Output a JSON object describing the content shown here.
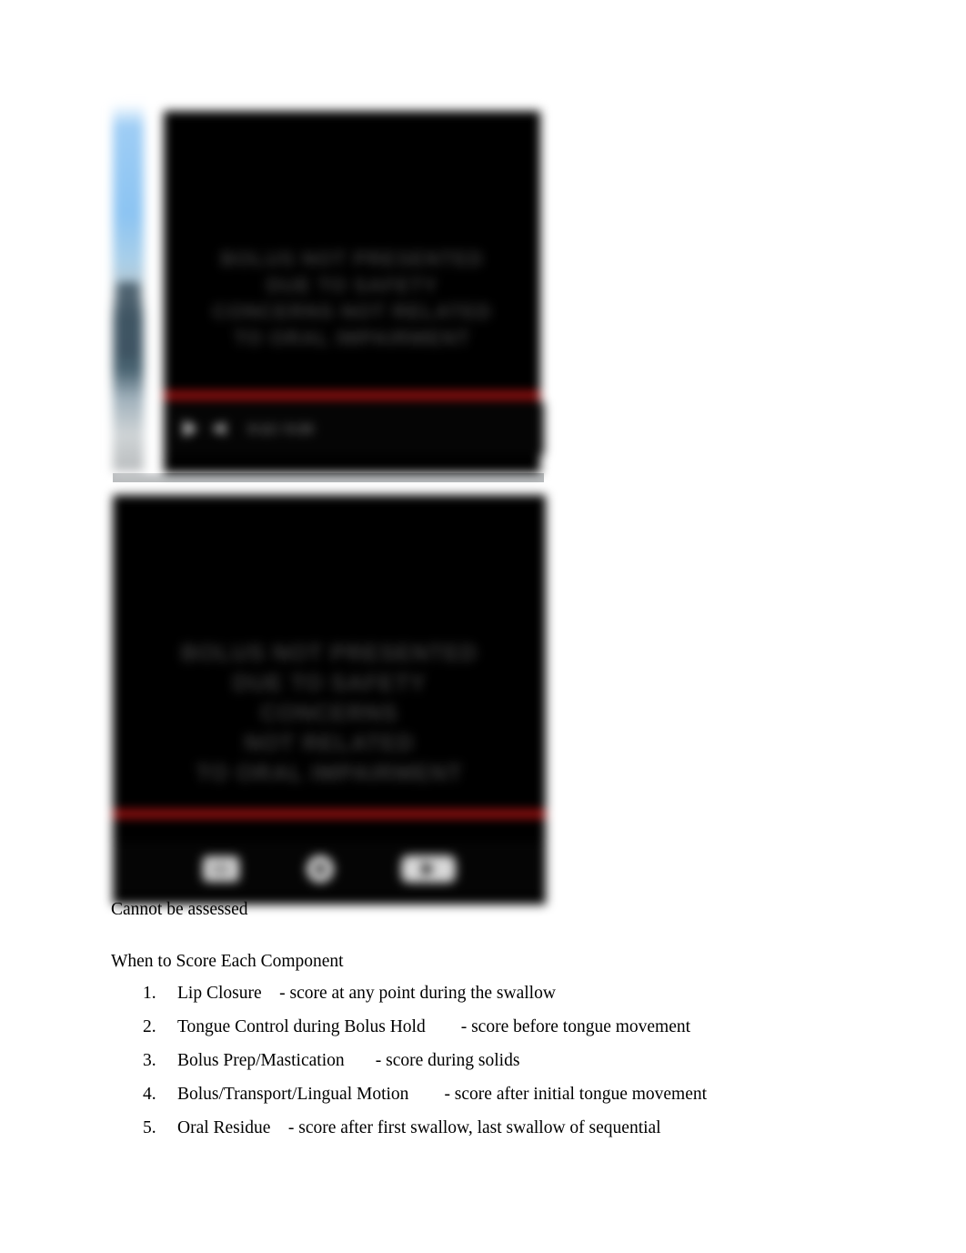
{
  "document": {
    "background_color": "#ffffff",
    "body_text_color": "#000000"
  },
  "media": {
    "capture_one": {
      "name": "embedded-video-screenshot-top",
      "caption_lines": [
        "BOLUS NOT PRESENTED",
        "DUE TO SAFETY",
        "CONCERNS NOT RELATED",
        "TO ORAL IMPAIRMENT"
      ],
      "progress_color": "#a81212",
      "progress_percent": 100,
      "controls": {
        "play_label": "play-button",
        "volume_label": "volume-button",
        "timecode": "0:12 / 0:20"
      }
    },
    "capture_two": {
      "name": "embedded-video-screenshot-bottom",
      "caption_lines": [
        "BOLUS NOT PRESENTED",
        "DUE TO SAFETY",
        "CONCERNS",
        "NOT RELATED",
        "TO ORAL IMPAIRMENT"
      ],
      "progress_color": "#a81212",
      "progress_percent": 100,
      "controls": {
        "cc_label": "CC",
        "settings_label": "settings-gear",
        "youtube_label": "youtube-logo"
      }
    }
  },
  "content": {
    "image_caption": "Cannot be assessed",
    "section_heading": "When to Score Each Component",
    "score_list": [
      {
        "number": "1.",
        "term": "Lip Closure",
        "gap": "    ",
        "description": "- score at any point during the swallow"
      },
      {
        "number": "2.",
        "term": "Tongue Control during Bolus Hold",
        "gap": "        ",
        "description": "- score before tongue movement"
      },
      {
        "number": "3.",
        "term": "Bolus Prep/Mastication",
        "gap": "       ",
        "description": "- score during solids"
      },
      {
        "number": "4.",
        "term": "Bolus/Transport/Lingual Motion",
        "gap": "        ",
        "description": "- score after initial tongue movement"
      },
      {
        "number": "5.",
        "term": "Oral Residue",
        "gap": "    ",
        "description": "- score after first swallow, last swallow of sequential"
      }
    ]
  }
}
